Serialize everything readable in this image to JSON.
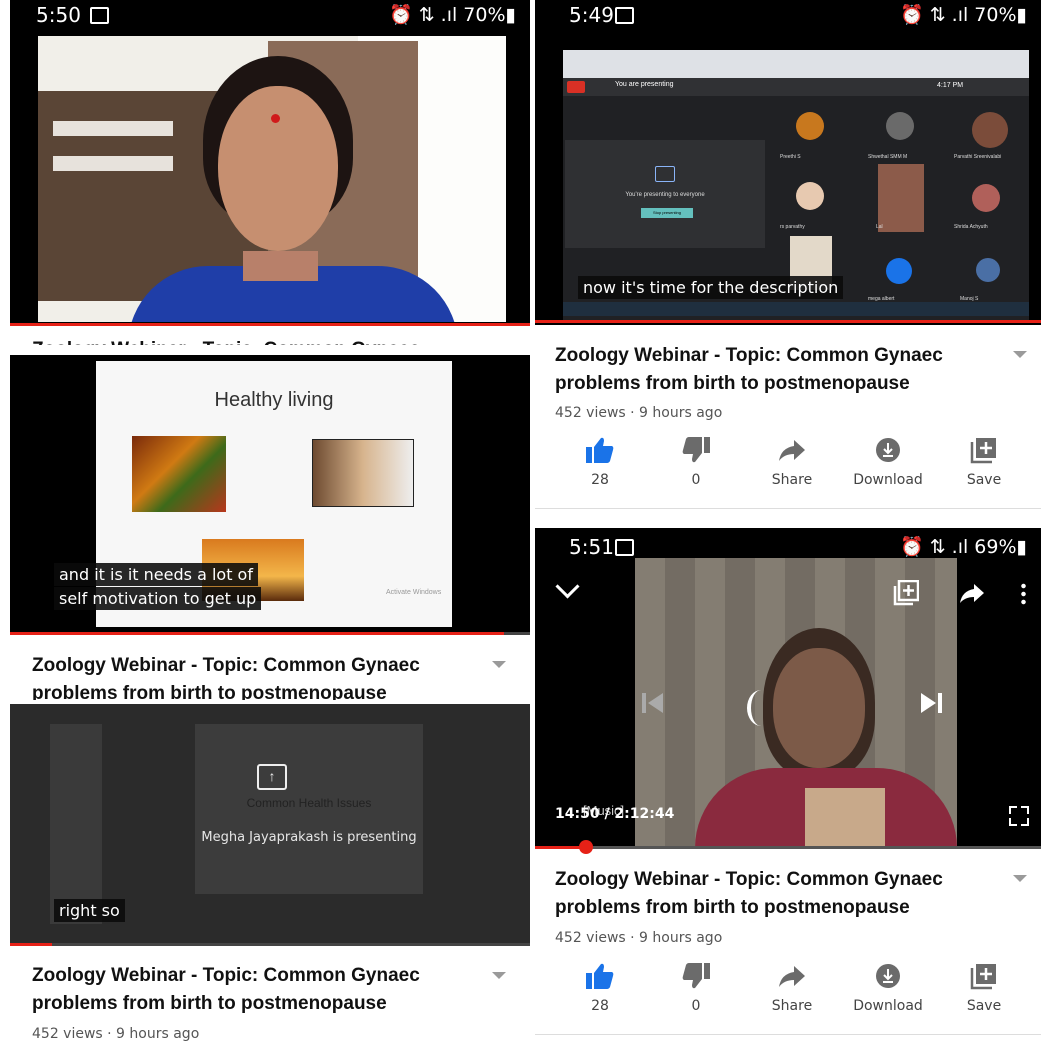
{
  "panel1": {
    "time": "5:50",
    "status_right": "⏰ ⇅ .ıl 70%▮",
    "title_cut": "Zoology Webinar - Topic: Common Gynaec"
  },
  "panel2": {
    "time": "5:49",
    "status_right": "⏰ ⇅ .ıl 70%▮",
    "meet_presenting": "You are presenting",
    "meet_share_text": "You're presenting to everyone",
    "meet_stop": "Stop presenting",
    "meet_time": "4:17 PM",
    "participants": [
      "Preethi S",
      "Shwethal SMM M",
      "Parvathi Sreenivalabi",
      "rs parvathy",
      "Lal",
      "Shrida Achyuth",
      "",
      "mega albert",
      "Manoj S"
    ],
    "caption": "now it's time for the description",
    "title": "Zoology Webinar - Topic: Common Gynaec problems from birth to postmenopause",
    "meta": "452 views · 9 hours ago",
    "likes": "28",
    "dislikes": "0",
    "share": "Share",
    "download": "Download",
    "save": "Save"
  },
  "panel3": {
    "slide_title": "Healthy living",
    "watermark": "Activate Windows",
    "caption_l1": "and it is it needs a lot of",
    "caption_l2": "self motivation to get up",
    "title_l1": "Zoology Webinar - Topic: Common Gynaec",
    "title_l2": "problems from birth to postmenopause"
  },
  "panel4": {
    "slide_heading": "Common Health Issues",
    "presenter": "Megha Jayaprakash is presenting",
    "caption": "right so",
    "title": "Zoology Webinar - Topic: Common Gynaec problems from birth to postmenopause",
    "meta": "452 views · 9 hours ago"
  },
  "panel5": {
    "time": "5:51",
    "status_right": "⏰ ⇅ .ıl 69%▮",
    "timestamp": "14:50 / 2:12:44",
    "music_caption": "[Music]",
    "progress": 0.0187,
    "title": "Zoology Webinar - Topic: Common Gynaec problems from birth to postmenopause",
    "meta": "452 views · 9 hours ago",
    "likes": "28",
    "dislikes": "0",
    "share": "Share",
    "download": "Download",
    "save": "Save"
  },
  "colors": {
    "accent": "#e62117",
    "like_blue": "#1a73e8"
  }
}
